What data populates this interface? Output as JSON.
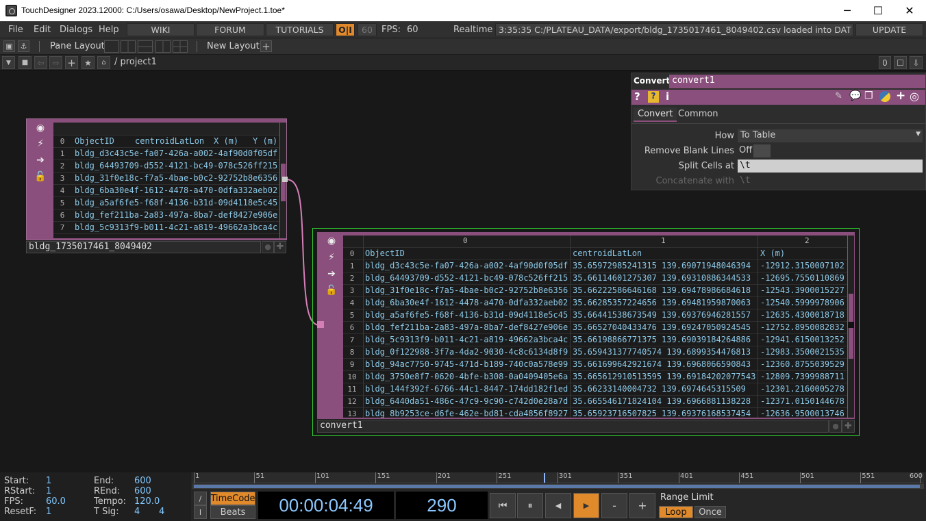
{
  "window": {
    "title": "TouchDesigner 2023.12000: C:/Users/osawa/Desktop/NewProject.1.toe*",
    "minimize": "─",
    "maximize": "☐",
    "close": "✕"
  },
  "menu": {
    "items": [
      "File",
      "Edit",
      "Dialogs",
      "Help"
    ],
    "wiki": "WIKI",
    "forum": "FORUM",
    "tutorials": "TUTORIALS",
    "oi": "O|I",
    "fps_box": "60",
    "fps_label": "FPS:",
    "fps_value": "60",
    "realtime_label": "Realtime",
    "realtime_checked": true,
    "status": "3:35:35 C:/PLATEAU_DATA/export/bldg_1735017461_8049402.csv loaded into DAT /",
    "update": "UPDATE"
  },
  "toolbar": {
    "pane_layout": "Pane Layout",
    "new_layout": "New Layout",
    "plus": "+"
  },
  "pathbar": {
    "path": "/ project1",
    "zero": "0"
  },
  "node1": {
    "name": "bldg_1735017461_8049402",
    "header": [
      "ObjectID",
      "centroidLatLon",
      "X (m)",
      "Y (m)"
    ],
    "rows": [
      {
        "n": "1",
        "id": "bldg_d3c43c5e-fa07-426a-a002-4af90d0f05df"
      },
      {
        "n": "2",
        "id": "bldg_64493709-d552-4121-bc49-078c526ff215"
      },
      {
        "n": "3",
        "id": "bldg_31f0e18c-f7a5-4bae-b0c2-92752b8e6356"
      },
      {
        "n": "4",
        "id": "bldg_6ba30e4f-1612-4478-a470-0dfa332aeb02"
      },
      {
        "n": "5",
        "id": "bldg_a5af6fe5-f68f-4136-b31d-09d4118e5c45"
      },
      {
        "n": "6",
        "id": "bldg_fef211ba-2a83-497a-8ba7-def8427e906e"
      },
      {
        "n": "7",
        "id": "bldg_5c9313f9-b011-4c21-a819-49662a3bca4c"
      }
    ]
  },
  "node2": {
    "name": "convert1",
    "colnums": [
      "0",
      "1",
      "2"
    ],
    "header": {
      "id": "ObjectID",
      "latlon": "centroidLatLon",
      "x": "X (m)"
    },
    "rows": [
      {
        "n": "1",
        "id": "bldg_d3c43c5e-fa07-426a-a002-4af90d0f05df",
        "latlon": "35.65972985241315 139.69071948046394",
        "x": "-12912.3150007102"
      },
      {
        "n": "2",
        "id": "bldg_64493709-d552-4121-bc49-078c526ff215",
        "latlon": "35.66114601275307 139.69310886344533",
        "x": "-12695.7550110869"
      },
      {
        "n": "3",
        "id": "bldg_31f0e18c-f7a5-4bae-b0c2-92752b8e6356",
        "latlon": "35.66222586646168 139.69478986684618",
        "x": "-12543.3900015227"
      },
      {
        "n": "4",
        "id": "bldg_6ba30e4f-1612-4478-a470-0dfa332aeb02",
        "latlon": "35.66285357224656 139.69481959870063",
        "x": "-12540.5999978906"
      },
      {
        "n": "5",
        "id": "bldg_a5af6fe5-f68f-4136-b31d-09d4118e5c45",
        "latlon": "35.66441538673549 139.69376946281557",
        "x": "-12635.4300018718"
      },
      {
        "n": "6",
        "id": "bldg_fef211ba-2a83-497a-8ba7-def8427e906e",
        "latlon": "35.66527040433476 139.69247050924545",
        "x": "-12752.8950082832"
      },
      {
        "n": "7",
        "id": "bldg_5c9313f9-b011-4c21-a819-49662a3bca4c",
        "latlon": "35.66198866771375 139.69039184264886",
        "x": "-12941.6150013252"
      },
      {
        "n": "8",
        "id": "bldg_0f122988-3f7a-4da2-9030-4c8c6134d8f9",
        "latlon": "35.659431377740574 139.6899354476813",
        "x": "-12983.3500021535"
      },
      {
        "n": "9",
        "id": "bldg_94ac7750-9745-471d-b189-740c0a578e99",
        "latlon": "35.661699642921674 139.6968066590843",
        "x": "-12360.8755039529"
      },
      {
        "n": "10",
        "id": "bldg_3750e8f7-0620-4bfe-b308-0a0409405e6a",
        "latlon": "35.665612910513595 139.69184202077543",
        "x": "-12809.7399988711"
      },
      {
        "n": "11",
        "id": "bldg_144f392f-6766-44c1-8447-174dd182f1ed",
        "latlon": "35.66233140004732 139.6974645315509",
        "x": "-12301.2160005278"
      },
      {
        "n": "12",
        "id": "bldg_6440da51-486c-47c9-9c90-c742d0e28a7d",
        "latlon": "35.665546171824104 139.6966881138228",
        "x": "-12371.0150144678"
      },
      {
        "n": "13",
        "id": "bldg_8b9253ce-d6fe-462e-bd81-cda4856f8927",
        "latlon": "35.65923716507825 139.69376168537454",
        "x": "-12636.9500013746"
      }
    ]
  },
  "params": {
    "op_type": "Convert",
    "op_name": "convert1",
    "tabs": [
      "Convert",
      "Common"
    ],
    "how_label": "How",
    "how_value": "To Table",
    "remove_blank_label": "Remove Blank Lines",
    "remove_blank_value": "Off",
    "split_label": "Split Cells at",
    "split_value": "\\t",
    "concat_label": "Concatenate with",
    "concat_value": "\\t"
  },
  "timeline": {
    "start_label": "Start:",
    "start": "1",
    "end_label": "End:",
    "end": "600",
    "rstart_label": "RStart:",
    "rstart": "1",
    "rend_label": "REnd:",
    "rend": "600",
    "fps_label": "FPS:",
    "fps": "60.0",
    "tempo_label": "Tempo:",
    "tempo": "120.0",
    "resetf_label": "ResetF:",
    "resetf": "1",
    "tsig_label": "T Sig:",
    "tsig1": "4",
    "tsig2": "4",
    "ruler": [
      "1",
      "51",
      "101",
      "151",
      "201",
      "251",
      "301",
      "351",
      "401",
      "451",
      "501",
      "551",
      "600"
    ],
    "timecode_btn": "TimeCode",
    "beats_btn": "Beats",
    "slash": "/",
    "pipe": "I",
    "timecode": "00:00:04:49",
    "frame": "290",
    "range_limit": "Range Limit",
    "loop": "Loop",
    "once": "Once",
    "minus": "-",
    "plus": "+",
    "current_frame": 290,
    "range_end": 600
  }
}
